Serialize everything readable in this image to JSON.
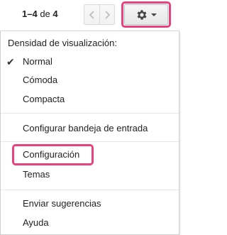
{
  "pager": {
    "range": "1–4",
    "of": "de",
    "total": "4"
  },
  "icons": {
    "prev": "chevron-left-icon",
    "next": "chevron-right-icon",
    "settings": "gear-icon",
    "dropdown": "caret-down-icon",
    "check": "checkmark-icon"
  },
  "menu": {
    "density_header": "Densidad de visualización:",
    "density_options": [
      {
        "label": "Normal",
        "selected": true
      },
      {
        "label": "Cómoda",
        "selected": false
      },
      {
        "label": "Compacta",
        "selected": false
      }
    ],
    "configure_inbox": "Configurar bandeja de entrada",
    "settings": "Configuración",
    "themes": "Temas",
    "send_feedback": "Enviar sugerencias",
    "help": "Ayuda"
  },
  "colors": {
    "highlight": "#e8417b"
  }
}
